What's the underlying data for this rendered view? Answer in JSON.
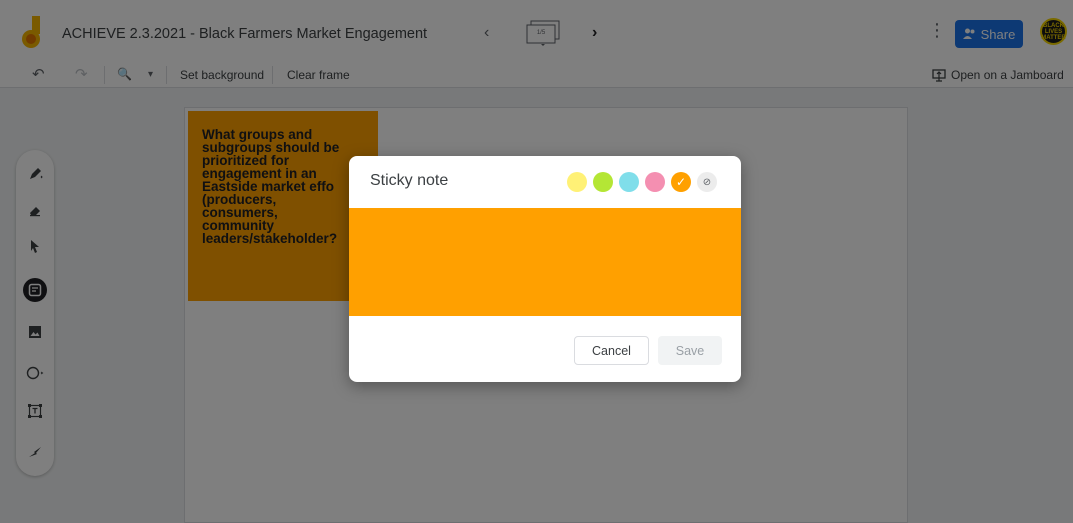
{
  "header": {
    "title": "ACHIEVE 2.3.2021 - Black Farmers Market Engagement",
    "frame_prev": "‹",
    "frame_count": "1/5",
    "frame_next": "›",
    "more": "⋮",
    "share_label": "Share",
    "avatar_text": "BLACK LIVES MATTER"
  },
  "toolbar": {
    "undo": "↶",
    "redo": "↷",
    "zoom": "🔍",
    "zoom_caret": "▾",
    "set_background": "Set background",
    "clear_frame": "Clear frame",
    "open_on_jamboard": "Open on a Jamboard"
  },
  "board": {
    "sticky_text": "What groups and\nsubgroups should be\nprioritized for\nengagement in an\nEastside market effo\n(producers,\nconsumers,\ncommunity\nleaders/stakeholder?"
  },
  "dialog": {
    "title": "Sticky note",
    "swatches": [
      {
        "name": "yellow",
        "color": "#fff176"
      },
      {
        "name": "green",
        "color": "#b4e635"
      },
      {
        "name": "blue",
        "color": "#80deea"
      },
      {
        "name": "pink",
        "color": "#f48fb1"
      },
      {
        "name": "orange",
        "color": "#ffa000",
        "selected": true
      },
      {
        "name": "transparent",
        "color": "#ececec"
      }
    ],
    "note_value": "",
    "cancel_label": "Cancel",
    "save_label": "Save"
  },
  "colors": {
    "accent": "#1a73e8",
    "sticky_orange": "#ffa000"
  }
}
